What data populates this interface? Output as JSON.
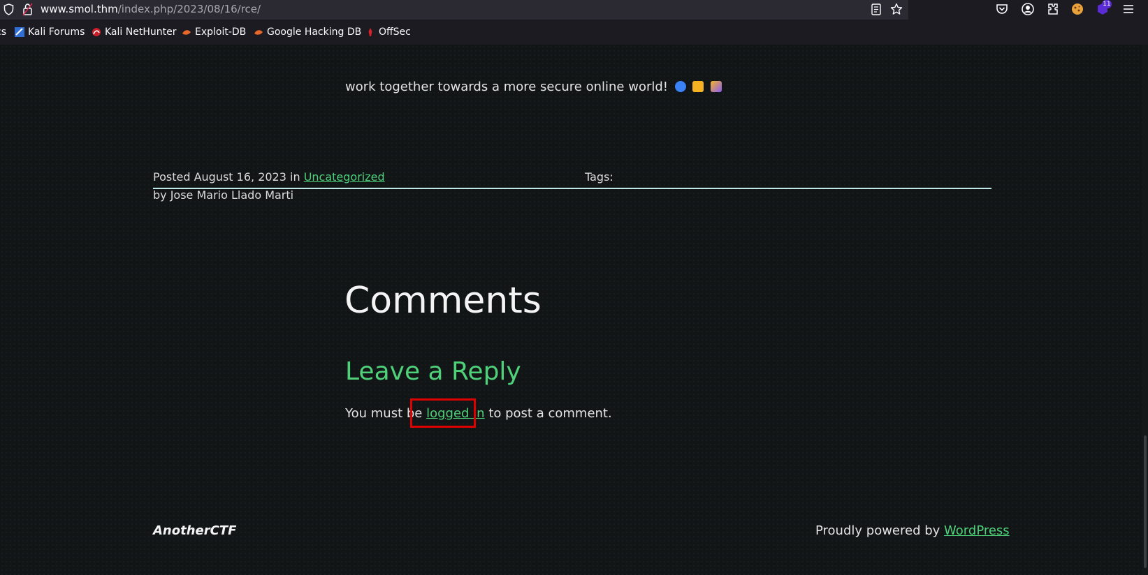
{
  "browser": {
    "url_host": "www.smol.thm",
    "url_path": "/index.php/2023/08/16/rce/",
    "extension_badge": "11",
    "bookmarks": [
      {
        "label": "cs",
        "icon": "bookmark-icon"
      },
      {
        "label": "Kali Forums",
        "icon": "kali-forums-icon"
      },
      {
        "label": "Kali NetHunter",
        "icon": "kali-nethunter-icon"
      },
      {
        "label": "Exploit-DB",
        "icon": "exploit-db-icon"
      },
      {
        "label": "Google Hacking DB",
        "icon": "google-hacking-db-icon"
      },
      {
        "label": "OffSec",
        "icon": "offsec-icon"
      }
    ]
  },
  "post": {
    "partial_last_line": "work together towards a more secure online world!",
    "posted_label": "Posted",
    "date": "August 16, 2023",
    "in_label": "in",
    "category": "Uncategorized",
    "by_line": "by Jose Mario Llado Marti",
    "tags_label": "Tags:"
  },
  "comments": {
    "heading": "Comments",
    "reply_heading": "Leave a Reply",
    "text_before": "You must be",
    "login_link": "logged in",
    "text_after": "to post a comment."
  },
  "footer": {
    "site_title": "AnotherCTF",
    "powered_text": "Proudly powered by",
    "powered_link": "WordPress"
  },
  "colors": {
    "accent": "#4fd17a",
    "background": "#111516",
    "separator": "#bfe8e6",
    "annotation": "#e00000"
  }
}
